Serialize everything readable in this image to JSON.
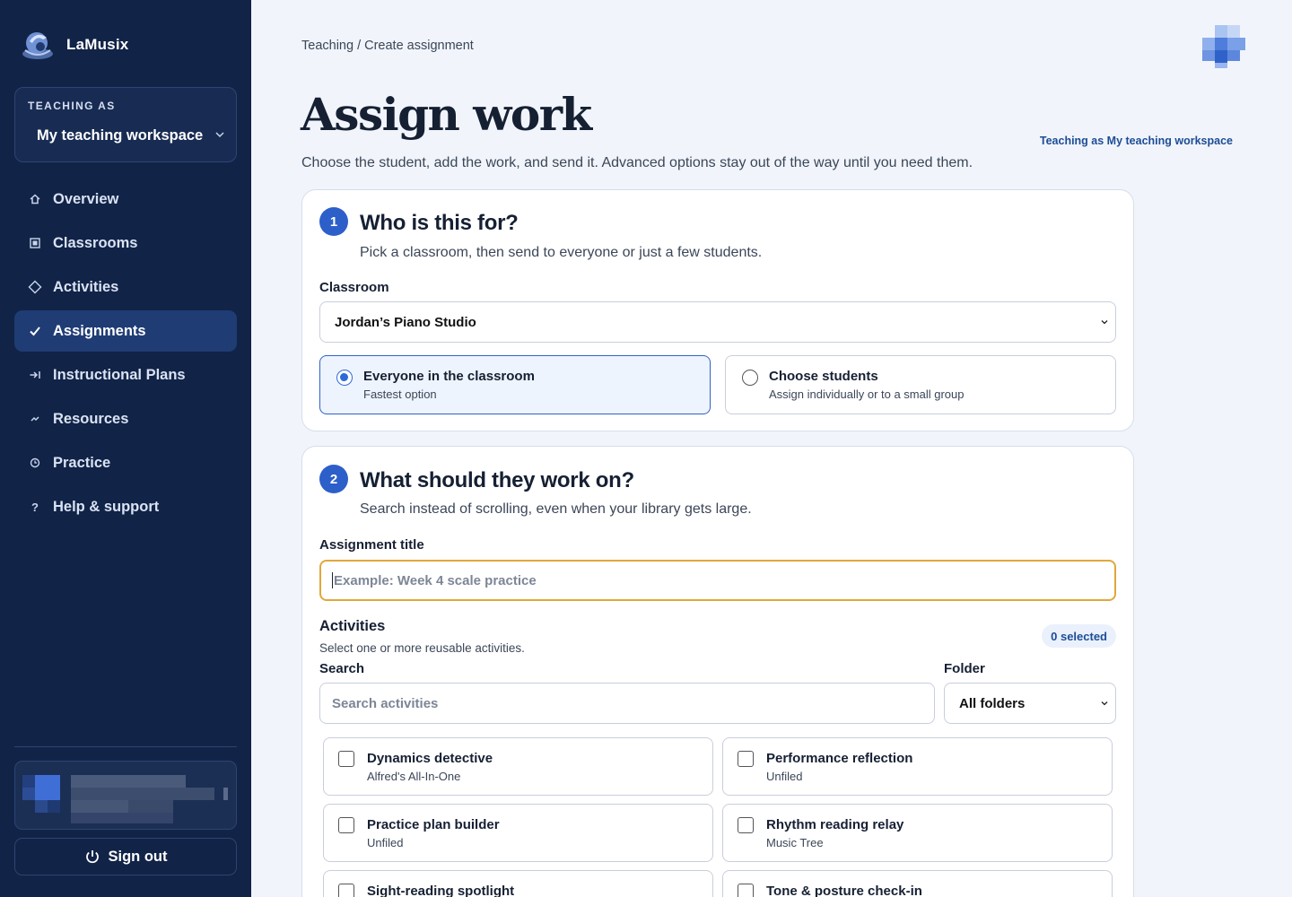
{
  "app": {
    "name": "LaMusix"
  },
  "workspace": {
    "caption": "TEACHING AS",
    "value": "My teaching workspace"
  },
  "nav": [
    {
      "label": "Overview",
      "icon": "home-icon"
    },
    {
      "label": "Classrooms",
      "icon": "classroom-icon"
    },
    {
      "label": "Activities",
      "icon": "diamond-icon"
    },
    {
      "label": "Assignments",
      "icon": "check-icon",
      "active": true
    },
    {
      "label": "Instructional Plans",
      "icon": "arrow-to-line-icon"
    },
    {
      "label": "Resources",
      "icon": "link-icon"
    },
    {
      "label": "Practice",
      "icon": "clock-icon"
    },
    {
      "label": "Help & support",
      "icon": "question-icon"
    }
  ],
  "signout": {
    "label": "Sign out"
  },
  "header": {
    "breadcrumb": "Teaching / Create assignment",
    "title": "Assign work",
    "teaching_note": "Teaching as My teaching workspace",
    "subtitle": "Choose the student, add the work, and send it. Advanced options stay out of the way until you need them."
  },
  "step1": {
    "number": "1",
    "title": "Who is this for?",
    "subtitle": "Pick a classroom, then send to everyone or just a few students.",
    "classroom_label": "Classroom",
    "classroom_value": "Jordan’s Piano Studio",
    "options": [
      {
        "title": "Everyone in the classroom",
        "desc": "Fastest option",
        "selected": true
      },
      {
        "title": "Choose students",
        "desc": "Assign individually or to a small group",
        "selected": false
      }
    ]
  },
  "step2": {
    "number": "2",
    "title": "What should they work on?",
    "subtitle": "Search instead of scrolling, even when your library gets large.",
    "title_label": "Assignment title",
    "title_placeholder": "Example: Week 4 scale practice",
    "activities_label": "Activities",
    "activities_desc": "Select one or more reusable activities.",
    "selected_badge": "0 selected",
    "search_label": "Search",
    "search_placeholder": "Search activities",
    "folder_label": "Folder",
    "folder_value": "All folders",
    "activities": [
      {
        "title": "Dynamics detective",
        "sub": "Alfred's All-In-One"
      },
      {
        "title": "Performance reflection",
        "sub": "Unfiled"
      },
      {
        "title": "Practice plan builder",
        "sub": "Unfiled"
      },
      {
        "title": "Rhythm reading relay",
        "sub": "Music Tree"
      },
      {
        "title": "Sight-reading spotlight",
        "sub": ""
      },
      {
        "title": "Tone & posture check-in",
        "sub": ""
      }
    ]
  },
  "colors": {
    "sidebar": "#112347",
    "accent": "#2c5fc9",
    "focus": "#e0a83a",
    "background": "#f1f5fb"
  }
}
